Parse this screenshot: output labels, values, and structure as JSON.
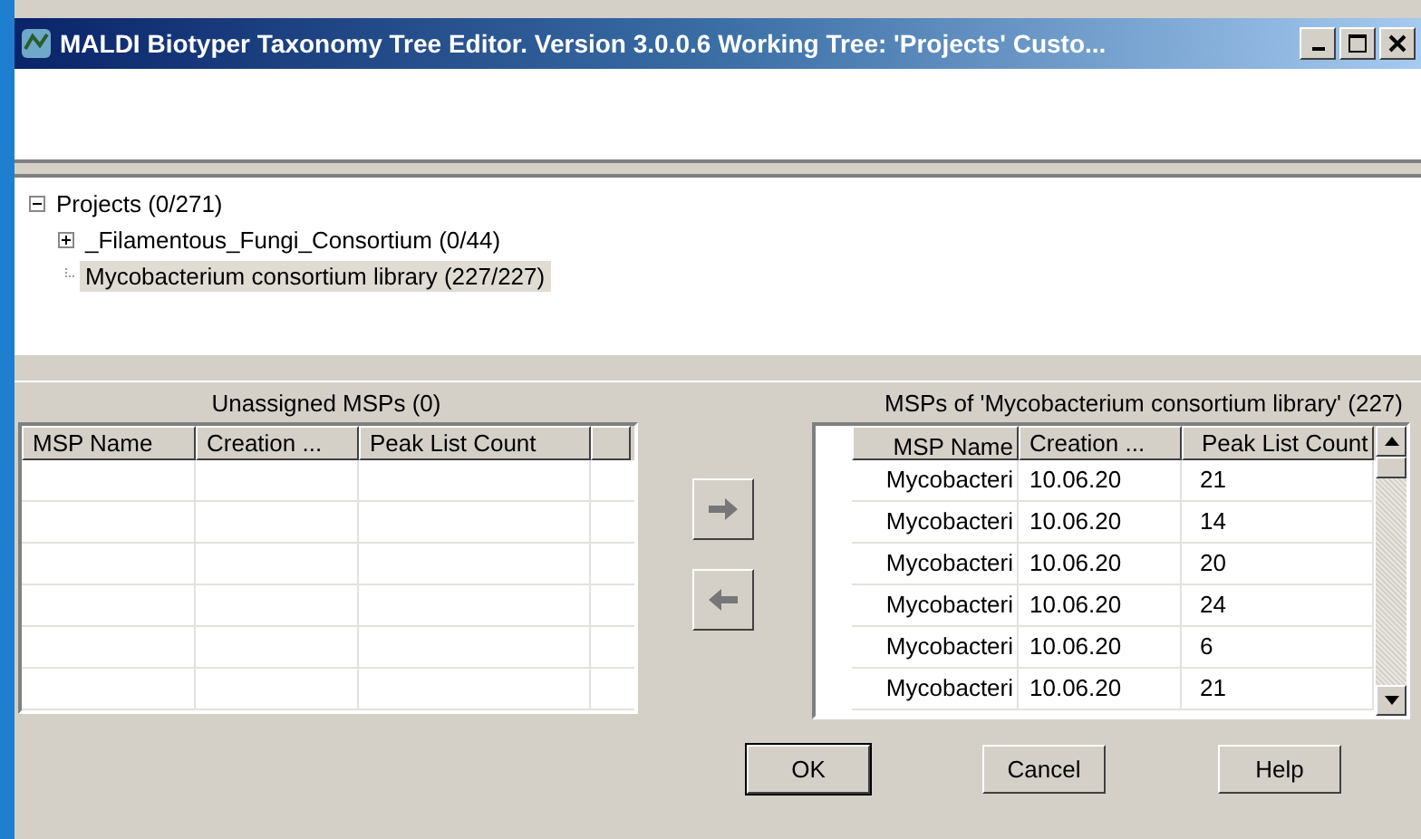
{
  "window": {
    "title": "MALDI Biotyper Taxonomy Tree Editor. Version 3.0.0.6 Working Tree: 'Projects' Custo..."
  },
  "tree": [
    {
      "kind": "branch",
      "label": "Projects (0/271)",
      "expanded": true,
      "selected": false,
      "children": [
        {
          "kind": "branch",
          "label": "_Filamentous_Fungi_Consortium (0/44)",
          "expanded": false,
          "selected": false
        },
        {
          "kind": "leaf",
          "label": "Mycobacterium consortium library (227/227)",
          "selected": true
        }
      ]
    }
  ],
  "unassigned": {
    "title": "Unassigned MSPs (0)",
    "columns": [
      "MSP Name",
      "Creation ...",
      "Peak List Count"
    ]
  },
  "assigned": {
    "title": "MSPs of 'Mycobacterium consortium library' (227)",
    "columns": [
      "MSP Name",
      "Creation ...",
      "Peak List Count"
    ],
    "rows": [
      [
        "Mycobacteri",
        "10.06.20",
        "21"
      ],
      [
        "Mycobacteri",
        "10.06.20",
        "14"
      ],
      [
        "Mycobacteri",
        "10.06.20",
        "20"
      ],
      [
        "Mycobacteri",
        "10.06.20",
        "24"
      ],
      [
        "Mycobacteri",
        "10.06.20",
        "6"
      ],
      [
        "Mycobacteri",
        "10.06.20",
        "21"
      ]
    ]
  },
  "buttons": [
    "OK",
    "Cancel",
    "Help"
  ]
}
